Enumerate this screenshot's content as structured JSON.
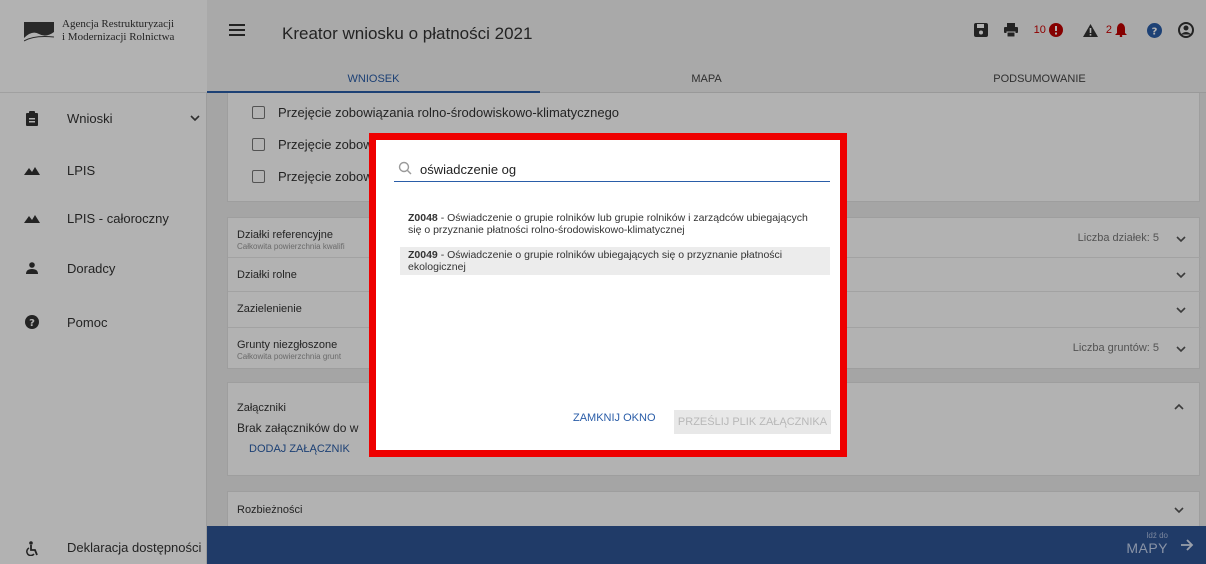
{
  "sidebar": {
    "logo_line1": "Agencja Restrukturyzacji",
    "logo_line2": "i Modernizacji Rolnictwa",
    "items": [
      {
        "label": "Wnioski",
        "icon": "clipboard-icon"
      },
      {
        "label": "LPIS",
        "icon": "mountain-icon"
      },
      {
        "label": "LPIS - całoroczny",
        "icon": "mountain-icon"
      },
      {
        "label": "Doradcy",
        "icon": "person-icon"
      },
      {
        "label": "Pomoc",
        "icon": "help-icon"
      }
    ],
    "accessibility": "Deklaracja dostępności"
  },
  "header": {
    "title": "Kreator wniosku o płatności 2021",
    "error_count": "10",
    "warning_count": "2"
  },
  "tabs": [
    "WNIOSEK",
    "MAPA",
    "PODSUMOWANIE"
  ],
  "checkboxes": [
    "Przejęcie zobowiązania rolno-środowiskowo-klimatycznego",
    "Przejęcie zobowi",
    "Przejęcie zobowi"
  ],
  "accordions": {
    "dzialki_ref": {
      "title": "Działki referencyjne",
      "sub": "Całkowita powierzchnia kwalifi",
      "right": "Liczba działek: 5"
    },
    "dzialki_rolne": {
      "title": "Działki rolne"
    },
    "zazielenienie": {
      "title": "Zazielenienie"
    },
    "grunty": {
      "title": "Grunty niezgłoszone",
      "sub": "Całkowita powierzchnia grunt",
      "right": "Liczba gruntów: 5"
    },
    "zalaczniki": {
      "title": "Załączniki",
      "empty": "Brak załączników do w",
      "add": "DODAJ ZAŁĄCZNIK"
    },
    "rozbieznosci": {
      "title": "Rozbieżności"
    }
  },
  "footer": {
    "goto_small": "Idź do",
    "goto_big": "MAPY"
  },
  "modal": {
    "search_value": "oświadczenie og",
    "results": [
      {
        "code": "Z0048",
        "text": " - Oświadczenie o grupie rolników lub grupie rolników i zarządców ubiegających się o przyznanie płatności rolno-środowiskowo-klimatycznej"
      },
      {
        "code": "Z0049",
        "text": " - Oświadczenie o grupie rolników ubiegających się o przyznanie płatności ekologicznej"
      }
    ],
    "close_label": "ZAMKNIJ OKNO",
    "send_label": "PRZEŚLIJ PLIK ZAŁĄCZNIKA"
  },
  "colors": {
    "accent": "#2a5da8",
    "highlight": "#ee0000",
    "footer": "#2f5596",
    "error": "#c00000"
  }
}
